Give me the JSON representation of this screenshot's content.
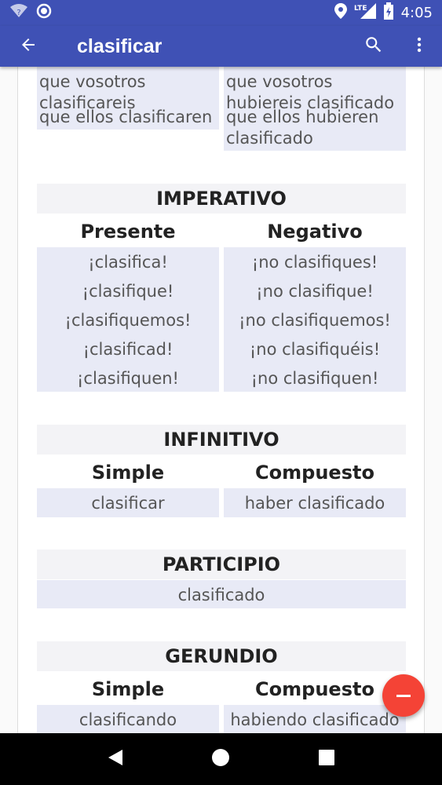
{
  "app_bar": {
    "title": "clasificar"
  },
  "status_bar": {
    "time": "4:05",
    "network": "LTE"
  },
  "subjunctive_tail": {
    "left": [
      {
        "text": "que vosotros clasificareis"
      },
      {
        "text": "que ellos clasificaren"
      }
    ],
    "right": [
      {
        "text": "que vosotros hubiereis clasificado"
      },
      {
        "text": "que ellos hubieren clasificado"
      }
    ]
  },
  "imperativo": {
    "title": "IMPERATIVO",
    "col1_title": "Presente",
    "col2_title": "Negativo",
    "presente": [
      "¡clasifica!",
      "¡clasifique!",
      "¡clasifiquemos!",
      "¡clasificad!",
      "¡clasifiquen!"
    ],
    "negativo": [
      "¡no clasifiques!",
      "¡no clasifique!",
      "¡no clasifiquemos!",
      "¡no clasifiquéis!",
      "¡no clasifiquen!"
    ]
  },
  "infinitivo": {
    "title": "INFINITIVO",
    "col1_title": "Simple",
    "col2_title": "Compuesto",
    "simple": "clasificar",
    "compuesto": "haber clasificado"
  },
  "participio": {
    "title": "PARTICIPIO",
    "value": "clasificado"
  },
  "gerundio": {
    "title": "GERUNDIO",
    "col1_title": "Simple",
    "col2_title": "Compuesto",
    "simple": "clasificando",
    "compuesto": "habiendo clasificado"
  },
  "icons": {
    "back": "arrow-back-icon",
    "search": "search-icon",
    "more": "more-vert-icon",
    "fab": "minus-icon"
  },
  "colors": {
    "primary": "#3f51b5",
    "cell_bg": "#e8eaf6",
    "fab": "#f44336"
  }
}
